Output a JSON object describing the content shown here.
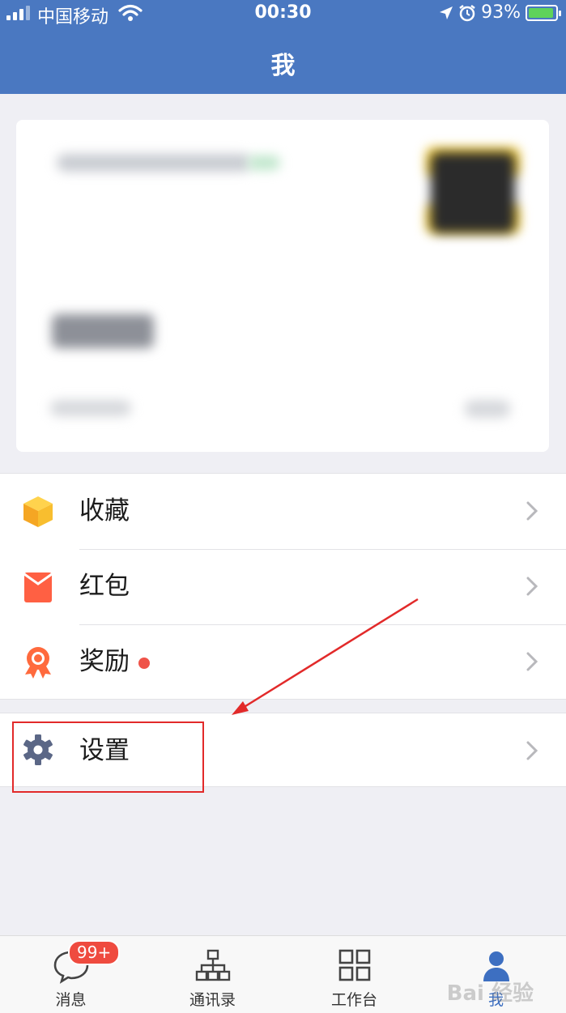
{
  "status_bar": {
    "carrier": "中国移动",
    "time": "00:30",
    "battery": "93%",
    "battery_level": 0.93
  },
  "nav": {
    "title": "我"
  },
  "menu": {
    "group1": [
      {
        "label": "收藏",
        "icon": "cube-icon"
      },
      {
        "label": "红包",
        "icon": "red-envelope-icon"
      },
      {
        "label": "奖励",
        "icon": "award-icon",
        "has_dot": true
      }
    ],
    "group2": [
      {
        "label": "设置",
        "icon": "gear-icon"
      }
    ]
  },
  "tabs": [
    {
      "label": "消息",
      "icon": "chat-bubble-icon",
      "badge": "99+"
    },
    {
      "label": "通讯录",
      "icon": "org-chart-icon"
    },
    {
      "label": "工作台",
      "icon": "grid-icon"
    },
    {
      "label": "我",
      "icon": "person-icon",
      "active": true
    }
  ],
  "watermark": "Bai 经验",
  "colors": {
    "header": "#4a78c1",
    "accent": "#3d6fc1",
    "badge": "#ef4b3f",
    "annotation": "#e22a2a"
  }
}
